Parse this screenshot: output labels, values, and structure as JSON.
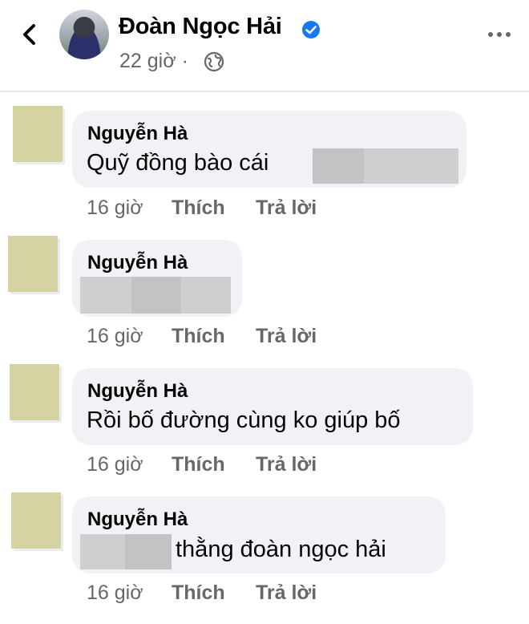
{
  "header": {
    "title": "Đoàn Ngọc Hải",
    "time": "22 giờ",
    "separator": "·"
  },
  "comments": [
    {
      "author": "Nguyễn Hà",
      "text": "Quỹ đồng bào cái",
      "time": "16 giờ",
      "like": "Thích",
      "reply": "Trả lời"
    },
    {
      "author": "Nguyễn Hà",
      "text": "",
      "time": "16 giờ",
      "like": "Thích",
      "reply": "Trả lời"
    },
    {
      "author": "Nguyễn Hà",
      "text": "Rồi bố đường cùng ko giúp bố",
      "time": "16 giờ",
      "like": "Thích",
      "reply": "Trả lời"
    },
    {
      "author": "Nguyễn Hà",
      "text": "thằng đoàn ngọc hải",
      "time": "16 giờ",
      "like": "Thích",
      "reply": "Trả lời"
    }
  ],
  "colors": {
    "accent": "#1877f2",
    "bubble": "#f0f2f5",
    "secondary_text": "#65676b",
    "redaction": "#c3c3c6",
    "avatar_placeholder": "#d6d3a3"
  },
  "icons": [
    "chevron-left-icon",
    "verified-badge-icon",
    "globe-icon",
    "more-options-icon"
  ]
}
